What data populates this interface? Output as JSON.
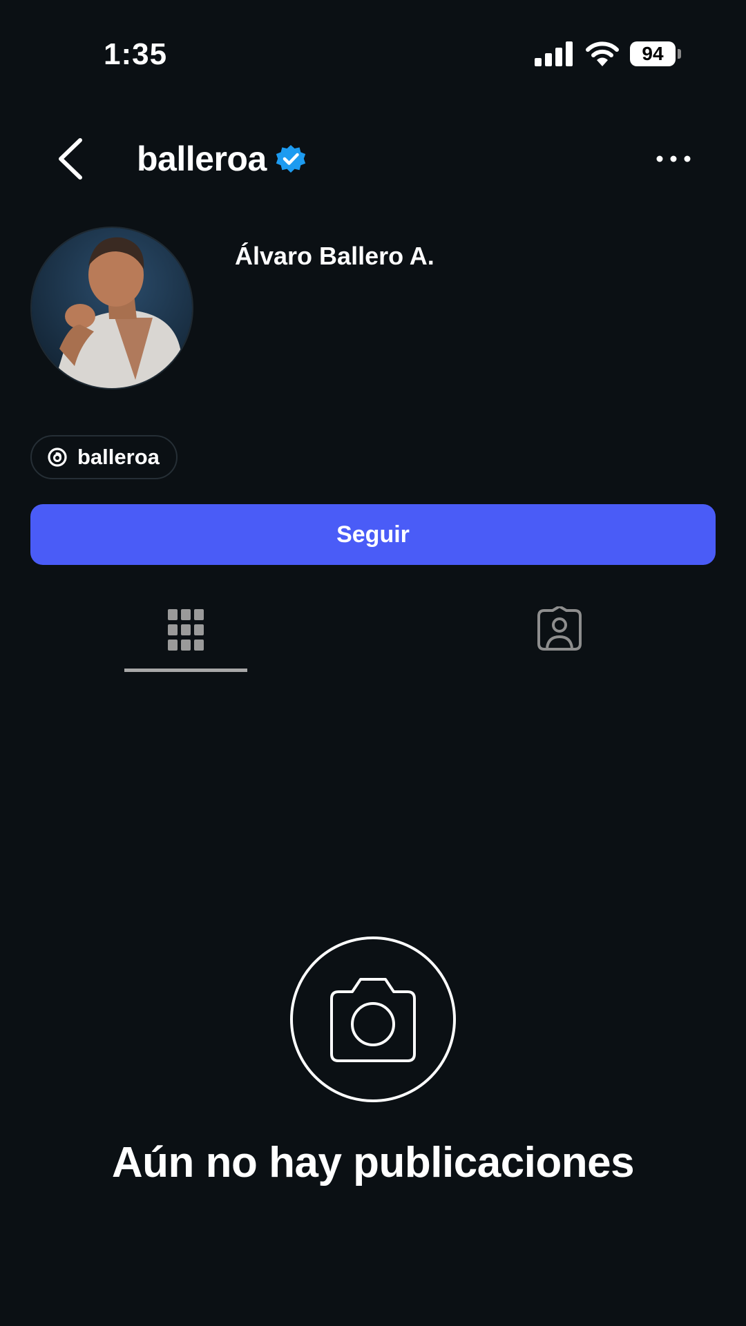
{
  "status_bar": {
    "time": "1:35",
    "battery_level": "94",
    "icons": [
      "signal-icon",
      "wifi-icon",
      "battery-icon"
    ]
  },
  "header": {
    "username": "balleroa",
    "verified": true,
    "back_icon": "chevron-left-icon",
    "more_icon": "more-horizontal-icon"
  },
  "profile": {
    "full_name": "Álvaro Ballero A.",
    "threads_handle": "balleroa",
    "follow_label": "Seguir"
  },
  "tabs": [
    {
      "name": "posts-grid",
      "icon": "grid-icon",
      "selected": true
    },
    {
      "name": "tagged",
      "icon": "tagged-person-icon",
      "selected": false
    }
  ],
  "empty_state": {
    "icon": "camera-icon",
    "message": "Aún no hay publicaciones"
  },
  "colors": {
    "background": "#0b1014",
    "accent": "#4a5cf7",
    "verified": "#1d9bf0",
    "text": "#ffffff",
    "muted": "#a8a8a8"
  }
}
